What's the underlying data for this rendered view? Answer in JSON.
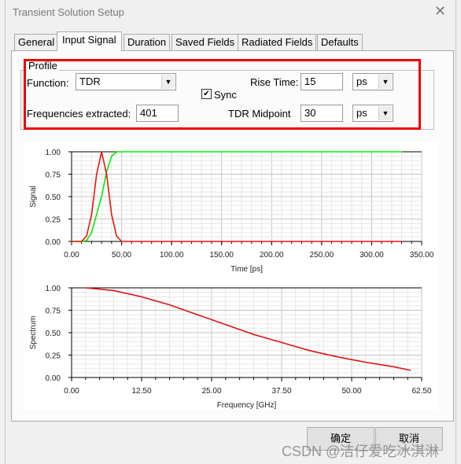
{
  "window": {
    "title": "Transient Solution Setup",
    "close_icon": "close-icon"
  },
  "tabs": [
    {
      "label": "General"
    },
    {
      "label": "Input Signal",
      "active": true
    },
    {
      "label": "Duration"
    },
    {
      "label": "Saved Fields"
    },
    {
      "label": "Radiated Fields"
    },
    {
      "label": "Defaults"
    }
  ],
  "profile": {
    "group_label": "Profile",
    "function_label": "Function:",
    "function_value": "TDR",
    "sync_label": "Sync",
    "sync_checked": true,
    "rise_time_label": "Rise Time:",
    "rise_time_value": "15",
    "rise_time_unit": "ps",
    "freq_label": "Frequencies extracted:",
    "freq_value": "401",
    "midpoint_label": "TDR Midpoint",
    "midpoint_value": "30",
    "midpoint_unit": "ps",
    "highlight_color": "#e00000"
  },
  "chart_data": [
    {
      "type": "line",
      "xlabel": "Time [ps]",
      "ylabel": "Signal",
      "xlim": [
        0,
        350
      ],
      "ylim": [
        0,
        1
      ],
      "xticks": [
        "0.00",
        "50.00",
        "100.00",
        "150.00",
        "200.00",
        "250.00",
        "300.00",
        "350.00"
      ],
      "yticks": [
        "0.00",
        "0.25",
        "0.50",
        "0.75",
        "1.00"
      ],
      "grid": true,
      "x": [
        0,
        10,
        15,
        20,
        25,
        30,
        35,
        40,
        45,
        50,
        330
      ],
      "series": [
        {
          "color": "#00ee00",
          "values": [
            0,
            0,
            0.01,
            0.1,
            0.3,
            0.5,
            0.78,
            0.95,
            1,
            1,
            1
          ]
        },
        {
          "color": "#ee1111",
          "values": [
            0,
            0,
            0.06,
            0.3,
            0.75,
            1,
            0.75,
            0.3,
            0.06,
            0,
            0
          ]
        }
      ]
    },
    {
      "type": "line",
      "xlabel": "Frequency [GHz]",
      "ylabel": "Spectrum",
      "xlim": [
        0,
        62.5
      ],
      "ylim": [
        0,
        1
      ],
      "xticks": [
        "0.00",
        "12.50",
        "25.00",
        "37.50",
        "50.00",
        "62.50"
      ],
      "yticks": [
        "0.00",
        "0.25",
        "0.50",
        "0.75",
        "1.00"
      ],
      "grid": true,
      "x": [
        2.5,
        7.5,
        12.5,
        17.5,
        22.5,
        27.5,
        32.5,
        37.5,
        42.5,
        47.5,
        52.5,
        57.5,
        60.5
      ],
      "series": [
        {
          "color": "#dd1111",
          "values": [
            1.0,
            0.97,
            0.9,
            0.81,
            0.7,
            0.59,
            0.48,
            0.39,
            0.3,
            0.23,
            0.17,
            0.12,
            0.08
          ]
        }
      ]
    }
  ],
  "buttons": {
    "ok": "确定",
    "cancel": "取消"
  },
  "watermark": "CSDN @洁仔爱吃冰淇淋"
}
